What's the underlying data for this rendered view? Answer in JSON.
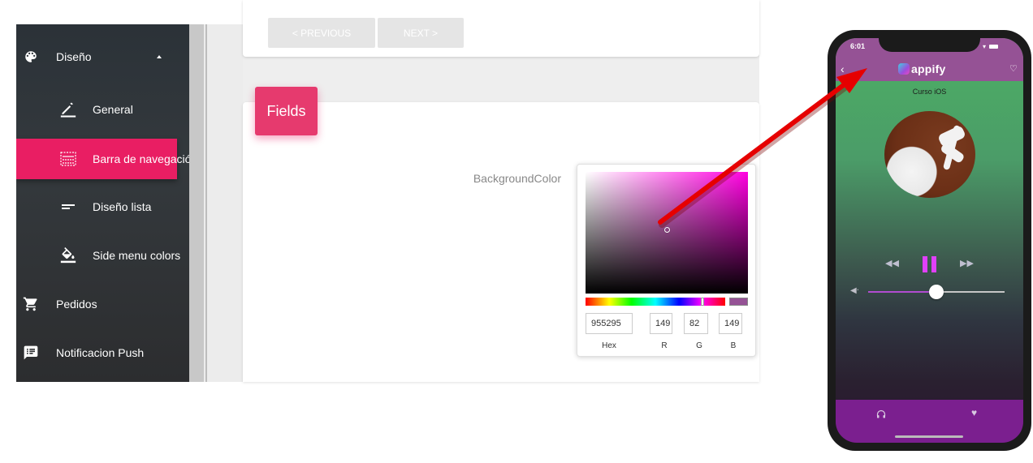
{
  "sidebar": {
    "items": [
      {
        "label": "Diseño",
        "icon": "palette-icon",
        "expanded": true
      },
      {
        "label": "General",
        "icon": "edit-icon"
      },
      {
        "label": "Barra de navegación",
        "icon": "navbar-icon",
        "active": true
      },
      {
        "label": "Diseño lista",
        "icon": "list-icon"
      },
      {
        "label": "Side menu colors",
        "icon": "paint-bucket-icon"
      },
      {
        "label": "Pedidos",
        "icon": "cart-icon"
      },
      {
        "label": "Notificacion Push",
        "icon": "message-icon"
      }
    ],
    "active_color": "#e91e63"
  },
  "pager": {
    "previous_label": "< PREVIOUS",
    "next_label": "NEXT >"
  },
  "fields_tab": {
    "label": "Fields",
    "color": "#e63a6e"
  },
  "form": {
    "background_color_label": "BackgroundColor"
  },
  "color_picker": {
    "hex": "955295",
    "r": "149",
    "g": "82",
    "b": "149",
    "hex_label": "Hex",
    "r_label": "R",
    "g_label": "G",
    "b_label": "B",
    "swatch_color": "#955295",
    "hue_color": "#ff00e0"
  },
  "phone": {
    "status_time": "6:01",
    "app_name": "appify",
    "course_title": "Curso iOS",
    "header_color": "#955295",
    "tabbar_color": "#7b1f8f",
    "volume_level": 0.5
  }
}
